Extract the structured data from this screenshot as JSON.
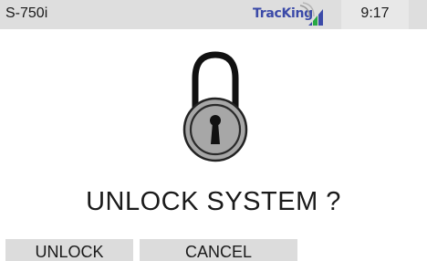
{
  "status_bar": {
    "device_model": "S-750i",
    "brand": "TracKing",
    "time": "9:17"
  },
  "dialog": {
    "title": "UNLOCK SYSTEM ?",
    "icon": "padlock-icon"
  },
  "buttons": {
    "unlock_label": "UNLOCK",
    "cancel_label": "CANCEL"
  },
  "colors": {
    "status_bar_bg": "#dedede",
    "brand_blue": "#3b4aa8",
    "signal_green": "#27a844",
    "button_bg": "#dcdcdc",
    "lock_body": "#a7a7a7"
  }
}
